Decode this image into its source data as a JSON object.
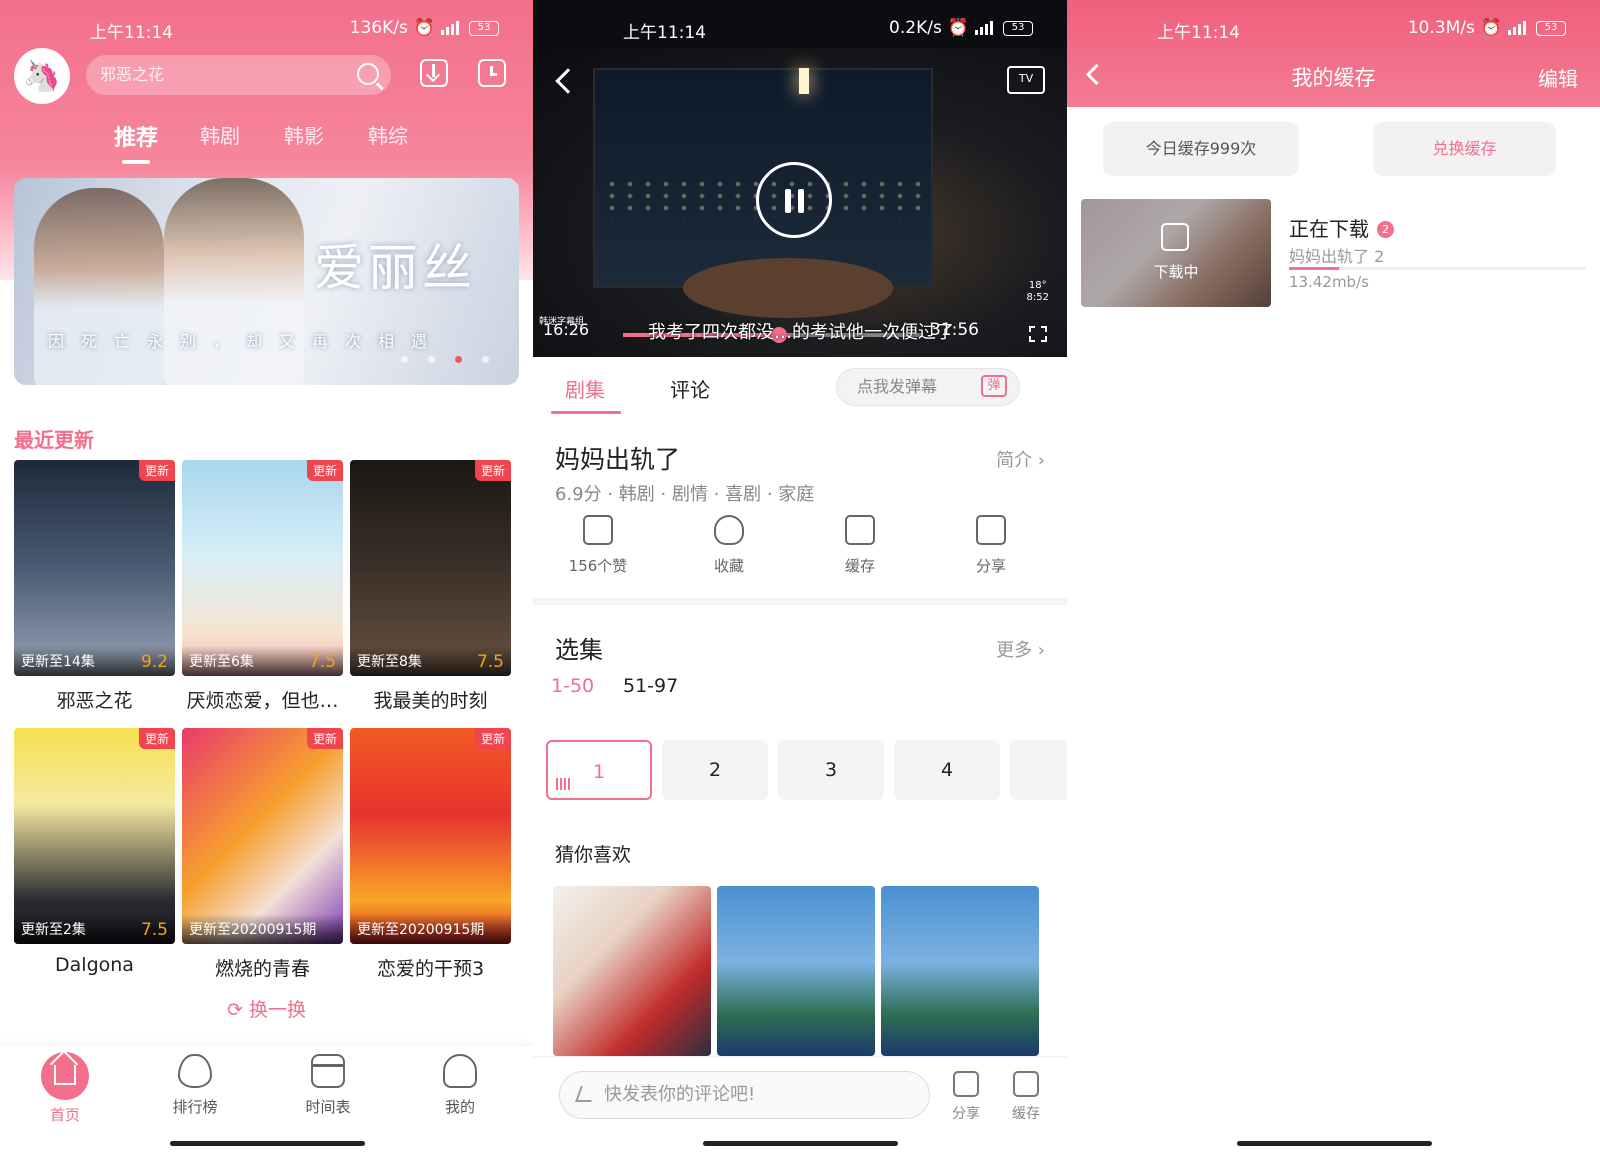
{
  "colors": {
    "accent": "#f36f8c",
    "badge": "#f0444f",
    "score": "#f6a11b"
  },
  "screen1": {
    "status": {
      "time": "上午11:14",
      "speed": "136K/s",
      "battery": "53"
    },
    "search": {
      "placeholder": "邪恶之花",
      "icon": "search-icon"
    },
    "icons": [
      "download-icon",
      "history-icon"
    ],
    "tabs": [
      "推荐",
      "韩剧",
      "韩影",
      "韩综"
    ],
    "active_tab": "推荐",
    "banner": {
      "title": "爱丽丝",
      "subtitle": "因死亡永别，却又再次相遇",
      "slide_index": 3,
      "slide_count": 4
    },
    "section_title": "最近更新",
    "cards": [
      {
        "name": "邪恶之花",
        "badge": "更新",
        "episodes": "更新至14集",
        "score": "9.2"
      },
      {
        "name": "厌烦恋爱，但也…",
        "badge": "更新",
        "episodes": "更新至6集",
        "score": "7.5"
      },
      {
        "name": "我最美的时刻",
        "badge": "更新",
        "episodes": "更新至8集",
        "score": "7.5"
      },
      {
        "name": "Dalgona",
        "badge": "更新",
        "episodes": "更新至2集",
        "score": "7.5"
      },
      {
        "name": "燃烧的青春",
        "badge": "更新",
        "episodes": "更新至20200915期",
        "score": ""
      },
      {
        "name": "恋爱的干预3",
        "badge": "更新",
        "episodes": "更新至20200915期",
        "score": ""
      }
    ],
    "refresh_label": "换一换",
    "nav": [
      {
        "label": "首页",
        "icon": "home-icon",
        "active": true
      },
      {
        "label": "排行榜",
        "icon": "flame-icon",
        "active": false
      },
      {
        "label": "时间表",
        "icon": "calendar-icon",
        "active": false
      },
      {
        "label": "我的",
        "icon": "profile-icon",
        "active": false
      }
    ]
  },
  "screen2": {
    "status": {
      "time": "上午11:14",
      "speed": "0.2K/s",
      "battery": "53"
    },
    "player": {
      "current_time": "16:26",
      "duration": "31:56",
      "subtitle": "我考了四次都没…的考试他一次便过了",
      "progress": 0.52,
      "channel_text": "韩迷字幕组",
      "clock": "8:52",
      "weather": "18°"
    },
    "tabs": [
      "剧集",
      "评论"
    ],
    "danmu_placeholder": "点我发弹幕",
    "danmu_icon_text": "弹",
    "title": "妈妈出轨了",
    "intro_label": "简介 ›",
    "meta": "6.9分 · 韩剧 · 剧情 · 喜剧 · 家庭",
    "actions": [
      {
        "label": "156个赞",
        "icon": "thumbs-up-icon"
      },
      {
        "label": "收藏",
        "icon": "heart-icon"
      },
      {
        "label": "缓存",
        "icon": "download-icon"
      },
      {
        "label": "分享",
        "icon": "share-icon"
      }
    ],
    "episodes_title": "选集",
    "more_label": "更多 ›",
    "ranges": [
      "1-50",
      "51-97"
    ],
    "episode_buttons": [
      "1",
      "2",
      "3",
      "4"
    ],
    "guess_title": "猜你喜欢",
    "comment_placeholder": "快发表你的评论吧!",
    "bottom_actions": [
      {
        "label": "分享",
        "icon": "share-icon"
      },
      {
        "label": "缓存",
        "icon": "download-icon"
      }
    ]
  },
  "screen3": {
    "status": {
      "time": "上午11:14",
      "speed": "10.3M/s",
      "battery": "53"
    },
    "title": "我的缓存",
    "edit_label": "编辑",
    "daily_quota": "今日缓存999次",
    "exchange_label": "兑换缓存",
    "download": {
      "heading": "正在下载",
      "count": "2",
      "overlay_text": "下载中",
      "item_name": "妈妈出轨了 2",
      "speed": "13.42mb/s",
      "progress": 0.17
    }
  }
}
